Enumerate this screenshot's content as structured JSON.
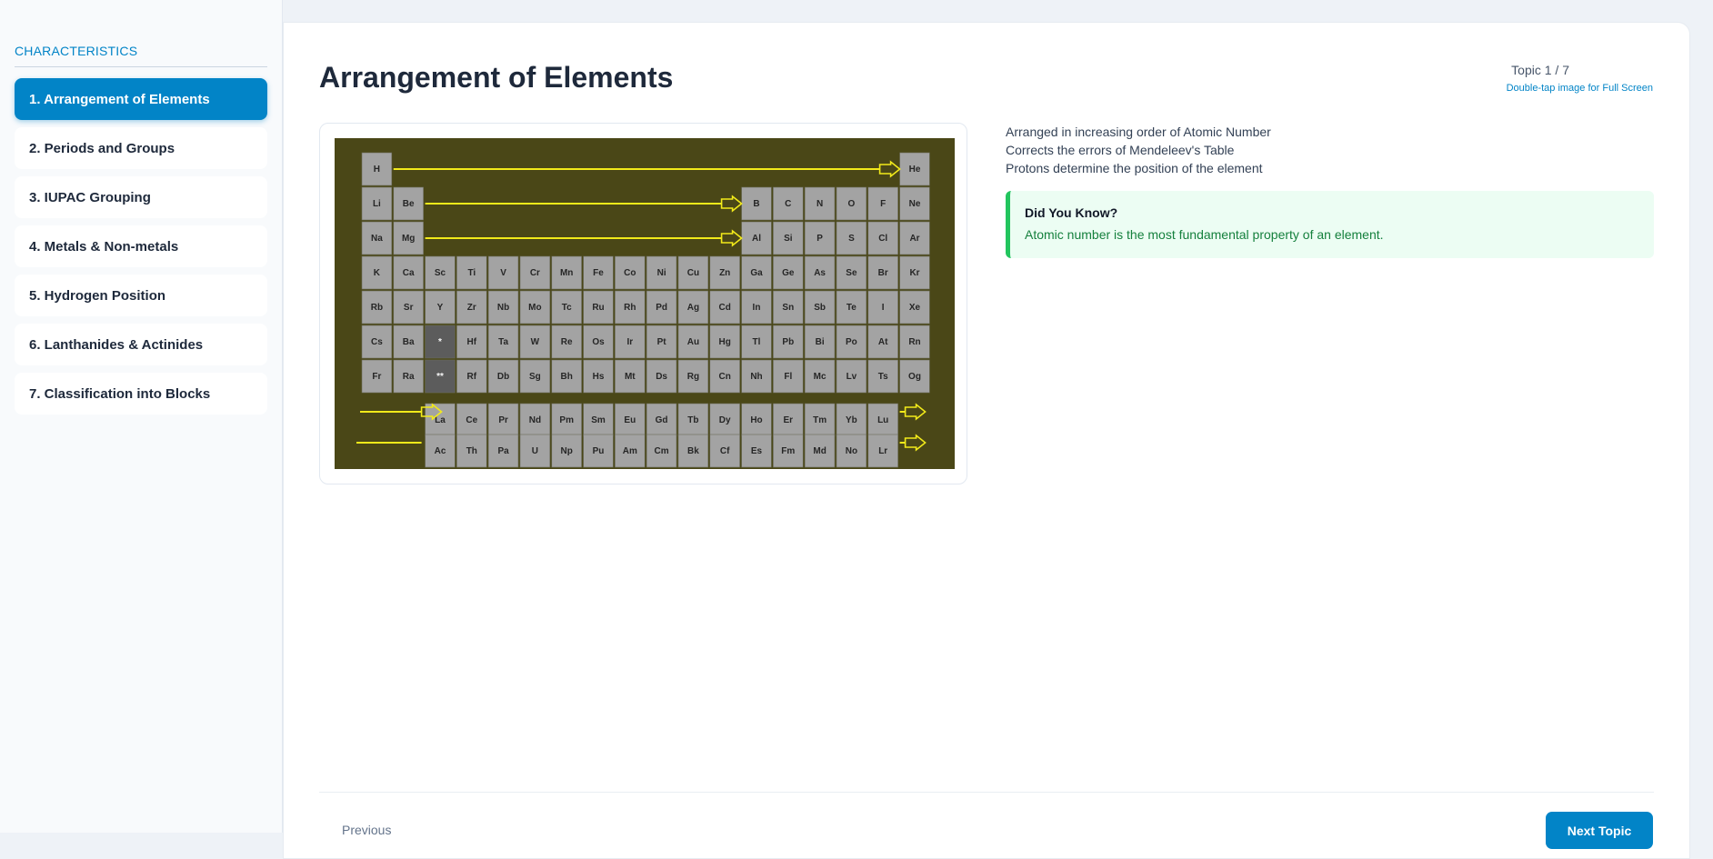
{
  "sidebar": {
    "heading": "CHARACTERISTICS",
    "items": [
      {
        "label": "1. Arrangement of Elements",
        "active": true
      },
      {
        "label": "2. Periods and Groups",
        "active": false
      },
      {
        "label": "3. IUPAC Grouping",
        "active": false
      },
      {
        "label": "4. Metals & Non-metals",
        "active": false
      },
      {
        "label": "5. Hydrogen Position",
        "active": false
      },
      {
        "label": "6. Lanthanides & Actinides",
        "active": false
      },
      {
        "label": "7. Classification into Blocks",
        "active": false
      }
    ]
  },
  "main": {
    "title": "Arrangement of Elements",
    "topic_counter": "Topic 1 / 7",
    "fullscreen_hint": "Double-tap image for Full Screen",
    "points": [
      "Arranged in increasing order of Atomic Number",
      "Corrects the errors of Mendeleev's Table",
      "Protons determine the position of the element"
    ],
    "did_you_know": {
      "title": "Did You Know?",
      "text": "Atomic number is the most fundamental property of an element."
    }
  },
  "periodic_table": {
    "rows": [
      [
        "H",
        "",
        "",
        "",
        "",
        "",
        "",
        "",
        "",
        "",
        "",
        "",
        "",
        "",
        "",
        "",
        "",
        "He"
      ],
      [
        "Li",
        "Be",
        "",
        "",
        "",
        "",
        "",
        "",
        "",
        "",
        "",
        "",
        "B",
        "C",
        "N",
        "O",
        "F",
        "Ne"
      ],
      [
        "Na",
        "Mg",
        "",
        "",
        "",
        "",
        "",
        "",
        "",
        "",
        "",
        "",
        "Al",
        "Si",
        "P",
        "S",
        "Cl",
        "Ar"
      ],
      [
        "K",
        "Ca",
        "Sc",
        "Ti",
        "V",
        "Cr",
        "Mn",
        "Fe",
        "Co",
        "Ni",
        "Cu",
        "Zn",
        "Ga",
        "Ge",
        "As",
        "Se",
        "Br",
        "Kr"
      ],
      [
        "Rb",
        "Sr",
        "Y",
        "Zr",
        "Nb",
        "Mo",
        "Tc",
        "Ru",
        "Rh",
        "Pd",
        "Ag",
        "Cd",
        "In",
        "Sn",
        "Sb",
        "Te",
        "I",
        "Xe"
      ],
      [
        "Cs",
        "Ba",
        "*",
        "Hf",
        "Ta",
        "W",
        "Re",
        "Os",
        "Ir",
        "Pt",
        "Au",
        "Hg",
        "Tl",
        "Pb",
        "Bi",
        "Po",
        "At",
        "Rn"
      ],
      [
        "Fr",
        "Ra",
        "**",
        "Rf",
        "Db",
        "Sg",
        "Bh",
        "Hs",
        "Mt",
        "Ds",
        "Rg",
        "Cn",
        "Nh",
        "Fl",
        "Mc",
        "Lv",
        "Ts",
        "Og"
      ]
    ],
    "lanthanides": [
      "La",
      "Ce",
      "Pr",
      "Nd",
      "Pm",
      "Sm",
      "Eu",
      "Gd",
      "Tb",
      "Dy",
      "Ho",
      "Er",
      "Tm",
      "Yb",
      "Lu"
    ],
    "actinides": [
      "Ac",
      "Th",
      "Pa",
      "U",
      "Np",
      "Pu",
      "Am",
      "Cm",
      "Bk",
      "Cf",
      "Es",
      "Fm",
      "Md",
      "No",
      "Lr"
    ],
    "colors": {
      "background": "#4a4717",
      "cell": "#a3a3a3",
      "placeholder": "#5c5c5c",
      "arrow": "#f2ea1a"
    }
  },
  "footer": {
    "previous_label": "Previous",
    "next_label": "Next Topic"
  }
}
